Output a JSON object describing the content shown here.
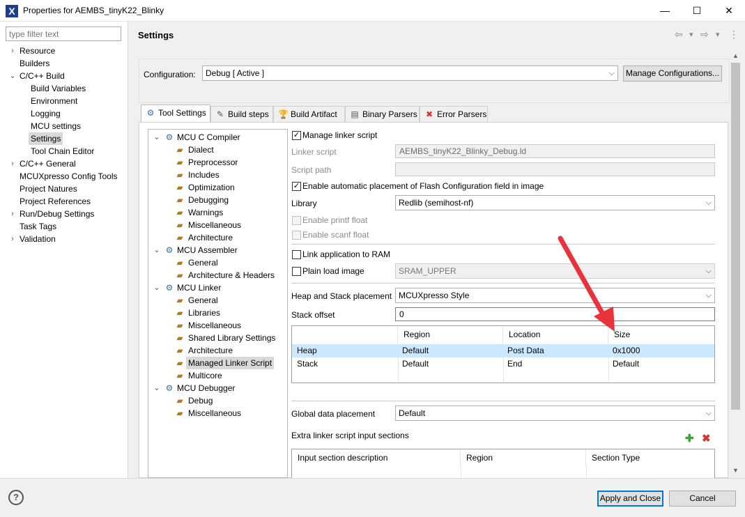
{
  "window": {
    "title": "Properties for AEMBS_tinyK22_Blinky",
    "app_icon": "X"
  },
  "controls": {
    "minimize": "—",
    "maximize": "☐",
    "close": "✕"
  },
  "filter": {
    "placeholder": "type filter text"
  },
  "nav": [
    {
      "label": "Resource",
      "expander": "›"
    },
    {
      "label": "Builders",
      "expander": ""
    },
    {
      "label": "C/C++ Build",
      "expander": "⌄"
    },
    {
      "label": "Build Variables",
      "expander": ""
    },
    {
      "label": "Environment",
      "expander": ""
    },
    {
      "label": "Logging",
      "expander": ""
    },
    {
      "label": "MCU settings",
      "expander": ""
    },
    {
      "label": "Settings",
      "expander": ""
    },
    {
      "label": "Tool Chain Editor",
      "expander": ""
    },
    {
      "label": "C/C++ General",
      "expander": "›"
    },
    {
      "label": "MCUXpresso Config Tools",
      "expander": ""
    },
    {
      "label": "Project Natures",
      "expander": ""
    },
    {
      "label": "Project References",
      "expander": ""
    },
    {
      "label": "Run/Debug Settings",
      "expander": "›"
    },
    {
      "label": "Task Tags",
      "expander": ""
    },
    {
      "label": "Validation",
      "expander": "›"
    }
  ],
  "header": {
    "title": "Settings",
    "back_icon": "⇦",
    "forward_icon": "⇨",
    "menu_icon": "⋮",
    "dropdown_icon": "▾"
  },
  "config": {
    "label": "Configuration:",
    "value": "Debug  [ Active ]",
    "manage_button": "Manage Configurations..."
  },
  "tabs": [
    {
      "label": "Tool Settings",
      "icon": "⚙"
    },
    {
      "label": "Build steps",
      "icon": "✎"
    },
    {
      "label": "Build Artifact",
      "icon": "🏆"
    },
    {
      "label": "Binary Parsers",
      "icon": "▤"
    },
    {
      "label": "Error Parsers",
      "icon": "✖"
    }
  ],
  "tree": [
    {
      "label": "MCU C Compiler",
      "expander": "⌄"
    },
    {
      "label": "Dialect"
    },
    {
      "label": "Preprocessor"
    },
    {
      "label": "Includes"
    },
    {
      "label": "Optimization"
    },
    {
      "label": "Debugging"
    },
    {
      "label": "Warnings"
    },
    {
      "label": "Miscellaneous"
    },
    {
      "label": "Architecture"
    },
    {
      "label": "MCU Assembler",
      "expander": "⌄"
    },
    {
      "label": "General"
    },
    {
      "label": "Architecture & Headers"
    },
    {
      "label": "MCU Linker",
      "expander": "⌄"
    },
    {
      "label": "General"
    },
    {
      "label": "Libraries"
    },
    {
      "label": "Miscellaneous"
    },
    {
      "label": "Shared Library Settings"
    },
    {
      "label": "Architecture"
    },
    {
      "label": "Managed Linker Script"
    },
    {
      "label": "Multicore"
    },
    {
      "label": "MCU Debugger",
      "expander": "⌄"
    },
    {
      "label": "Debug"
    },
    {
      "label": "Miscellaneous"
    }
  ],
  "form": {
    "manage_linker": {
      "label": "Manage linker script",
      "mark": "✓"
    },
    "linker_script": {
      "label": "Linker script",
      "value": "AEMBS_tinyK22_Blinky_Debug.ld"
    },
    "script_path": {
      "label": "Script path",
      "value": ""
    },
    "auto_placement": {
      "label": "Enable automatic placement of Flash Configuration field in image",
      "mark": "✓"
    },
    "library": {
      "label": "Library",
      "value": "Redlib (semihost-nf)"
    },
    "printf_float": {
      "label": "Enable printf float"
    },
    "scanf_float": {
      "label": "Enable scanf float"
    },
    "link_ram": {
      "label": "Link application to RAM"
    },
    "plain_load": {
      "label": "Plain load image",
      "value": "SRAM_UPPER"
    },
    "heap_stack": {
      "label": "Heap and Stack placement",
      "value": "MCUXpresso Style"
    },
    "stack_offset": {
      "label": "Stack offset",
      "value": "0"
    },
    "global_data": {
      "label": "Global data placement",
      "value": "Default"
    },
    "extra_sections": {
      "label": "Extra linker script input sections",
      "add_icon": "✚",
      "remove_icon": "✖"
    }
  },
  "heap_table": {
    "columns": [
      "",
      "Region",
      "Location",
      "Size"
    ],
    "rows": [
      [
        "Heap",
        "Default",
        "Post Data",
        "0x1000"
      ],
      [
        "Stack",
        "Default",
        "End",
        "Default"
      ]
    ]
  },
  "sections_table": {
    "columns": [
      "Input section description",
      "Region",
      "Section Type"
    ]
  },
  "footer": {
    "help": "?",
    "apply_close": "Apply and Close",
    "cancel": "Cancel"
  },
  "scroll": {
    "up": "▲",
    "down": "▼"
  },
  "colors": {
    "arrow": "#e8323c",
    "selection": "#cce8ff",
    "accent": "#0078d7"
  }
}
